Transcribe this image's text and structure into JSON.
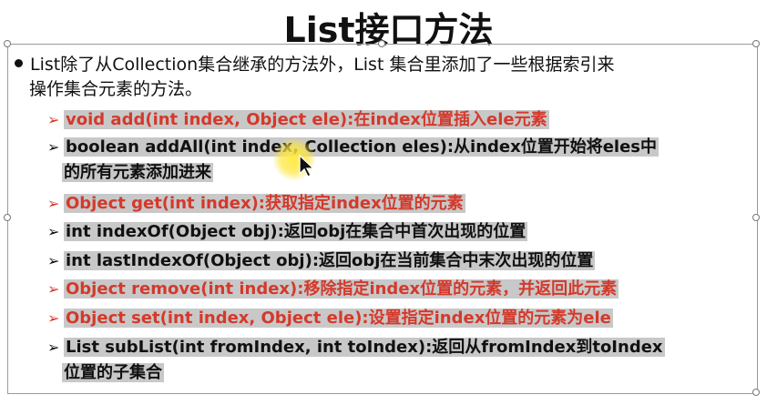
{
  "slide": {
    "title": "List接口方法",
    "intro_line1": "List除了从Collection集合继承的方法外，List 集合里添加了一些根据索引来",
    "intro_line2": "操作集合元素的方法。",
    "items": [
      {
        "text": "void add(int index, Object ele):在index位置插入ele元素",
        "color": "#d4392b"
      },
      {
        "text": "boolean addAll(int index, Collection eles):从index位置开始将eles中",
        "cont": "的所有元素添加进来",
        "color": "#111111"
      },
      {
        "text": "Object get(int index):获取指定index位置的元素",
        "color": "#d4392b"
      },
      {
        "text": "int indexOf(Object obj):返回obj在集合中首次出现的位置",
        "color": "#111111"
      },
      {
        "text": "int lastIndexOf(Object obj):返回obj在当前集合中末次出现的位置",
        "color": "#111111"
      },
      {
        "text": "Object remove(int index):移除指定index位置的元素，并返回此元素",
        "color": "#d4392b"
      },
      {
        "text": "Object set(int index, Object ele):设置指定index位置的元素为ele",
        "color": "#d4392b"
      },
      {
        "text": "List subList(int fromIndex, int toIndex):返回从fromIndex到toIndex",
        "cont": "位置的子集合",
        "color": "#111111"
      }
    ],
    "arrow_glyph": "➢",
    "highlight_color": "#c8c8c8"
  }
}
